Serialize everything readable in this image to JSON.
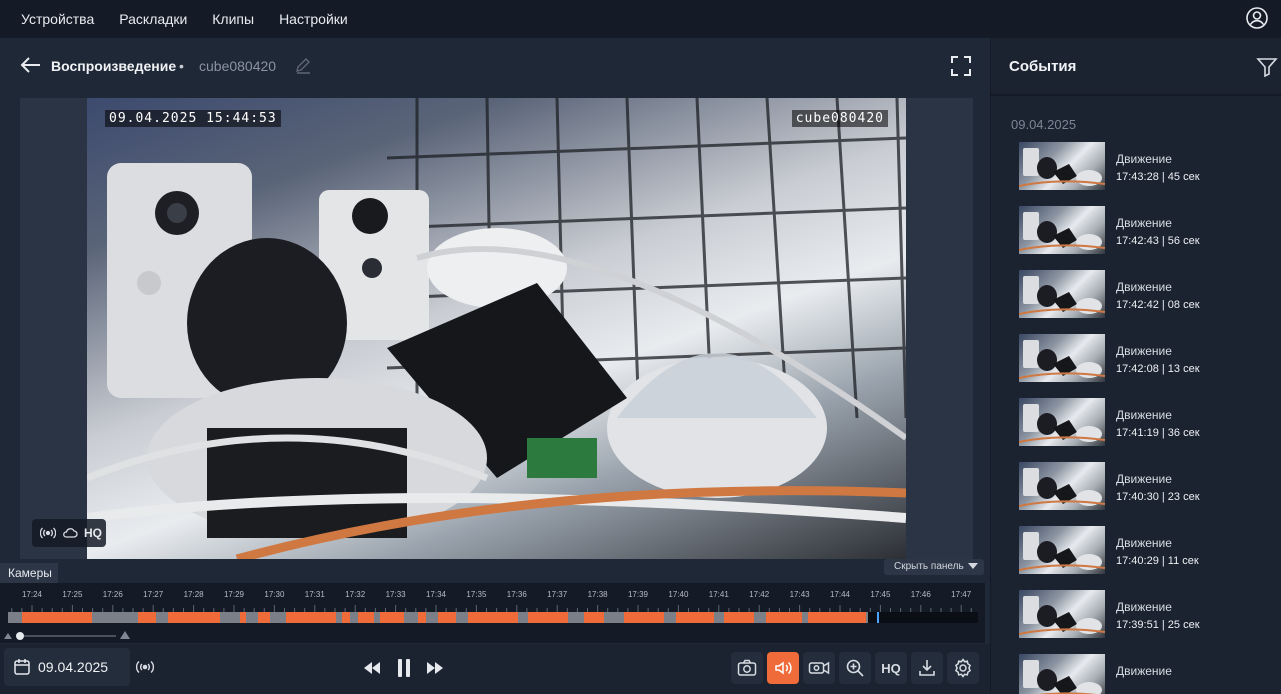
{
  "nav": {
    "items": [
      "Устройства",
      "Раскладки",
      "Клипы",
      "Настройки"
    ],
    "user_icon": "user-circle-icon"
  },
  "playback": {
    "title": "Воспроизведение",
    "separator": "•",
    "camera_name": "cube080420",
    "osd_datetime": "09.04.2025 15:44:53",
    "osd_camera": "cube080420",
    "stream_quality": "HQ"
  },
  "panel": {
    "cameras_tab": "Камеры",
    "hide_panel": "Скрыть панель"
  },
  "timeline": {
    "ticks": [
      "17:24",
      "17:25",
      "17:26",
      "17:27",
      "17:28",
      "17:29",
      "17:30",
      "17:31",
      "17:32",
      "17:33",
      "17:34",
      "17:35",
      "17:36",
      "17:37",
      "17:38",
      "17:39",
      "17:40",
      "17:41",
      "17:42",
      "17:43",
      "17:44",
      "17:45",
      "17:46",
      "17:47"
    ],
    "current_time": "17:45",
    "colors": {
      "recorded": "#ef6b3a",
      "gap": "#7a7f88",
      "future": "#0b0f15",
      "cursor": "#4aa3ff"
    }
  },
  "controls": {
    "date": "09.04.2025",
    "hq_label": "HQ",
    "accent": "#ef6b3a"
  },
  "events": {
    "title": "События",
    "date": "09.04.2025",
    "items": [
      {
        "type": "Движение",
        "time": "17:43:28 | 45 сек"
      },
      {
        "type": "Движение",
        "time": "17:42:43 | 56 сек"
      },
      {
        "type": "Движение",
        "time": "17:42:42 | 08 сек"
      },
      {
        "type": "Движение",
        "time": "17:42:08 | 13 сек"
      },
      {
        "type": "Движение",
        "time": "17:41:19 | 36 сек"
      },
      {
        "type": "Движение",
        "time": "17:40:30 | 23 сек"
      },
      {
        "type": "Движение",
        "time": "17:40:29 | 11 сек"
      },
      {
        "type": "Движение",
        "time": "17:39:51 | 25 сек"
      },
      {
        "type": "Движение",
        "time": ""
      }
    ]
  }
}
